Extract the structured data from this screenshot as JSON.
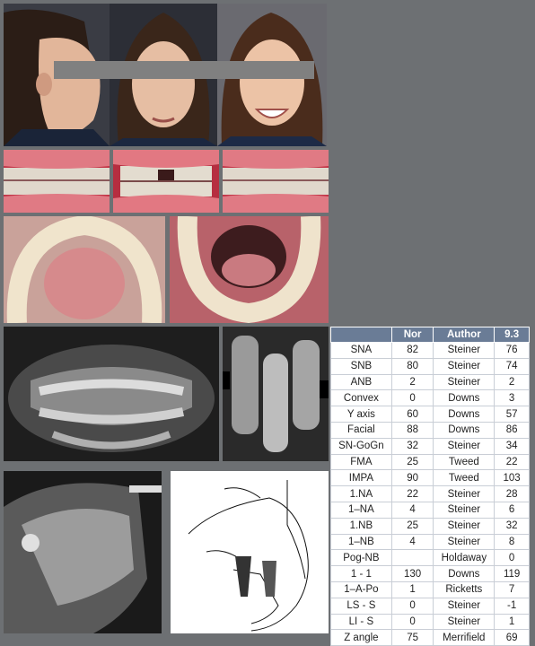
{
  "table": {
    "headers": [
      "",
      "Nor",
      "Author",
      "9.3"
    ],
    "rows": [
      [
        "SNA",
        "82",
        "Steiner",
        "76"
      ],
      [
        "SNB",
        "80",
        "Steiner",
        "74"
      ],
      [
        "ANB",
        "2",
        "Steiner",
        "2"
      ],
      [
        "Convex",
        "0",
        "Downs",
        "3"
      ],
      [
        "Y axis",
        "60",
        "Downs",
        "57"
      ],
      [
        "Facial",
        "88",
        "Downs",
        "86"
      ],
      [
        "SN-GoGn",
        "32",
        "Steiner",
        "34"
      ],
      [
        "FMA",
        "25",
        "Tweed",
        "22"
      ],
      [
        "IMPA",
        "90",
        "Tweed",
        "103"
      ],
      [
        "1.NA",
        "22",
        "Steiner",
        "28"
      ],
      [
        "1–NA",
        "4",
        "Steiner",
        "6"
      ],
      [
        "1.NB",
        "25",
        "Steiner",
        "32"
      ],
      [
        "1–NB",
        "4",
        "Steiner",
        "8"
      ],
      [
        "Pog-NB",
        "",
        "Holdaway",
        "0"
      ],
      [
        "1 - 1",
        "130",
        "Downs",
        "119"
      ],
      [
        "1–A-Po",
        "1",
        "Ricketts",
        "7"
      ],
      [
        "LS - S",
        "0",
        "Steiner",
        "-1"
      ],
      [
        "LI - S",
        "0",
        "Steiner",
        "1"
      ],
      [
        "Z angle",
        "75",
        "Merrifield",
        "69"
      ]
    ]
  },
  "colors": {
    "background": "#6d7073",
    "table_header": "#6a7c96",
    "table_border": "#c9ced6"
  }
}
